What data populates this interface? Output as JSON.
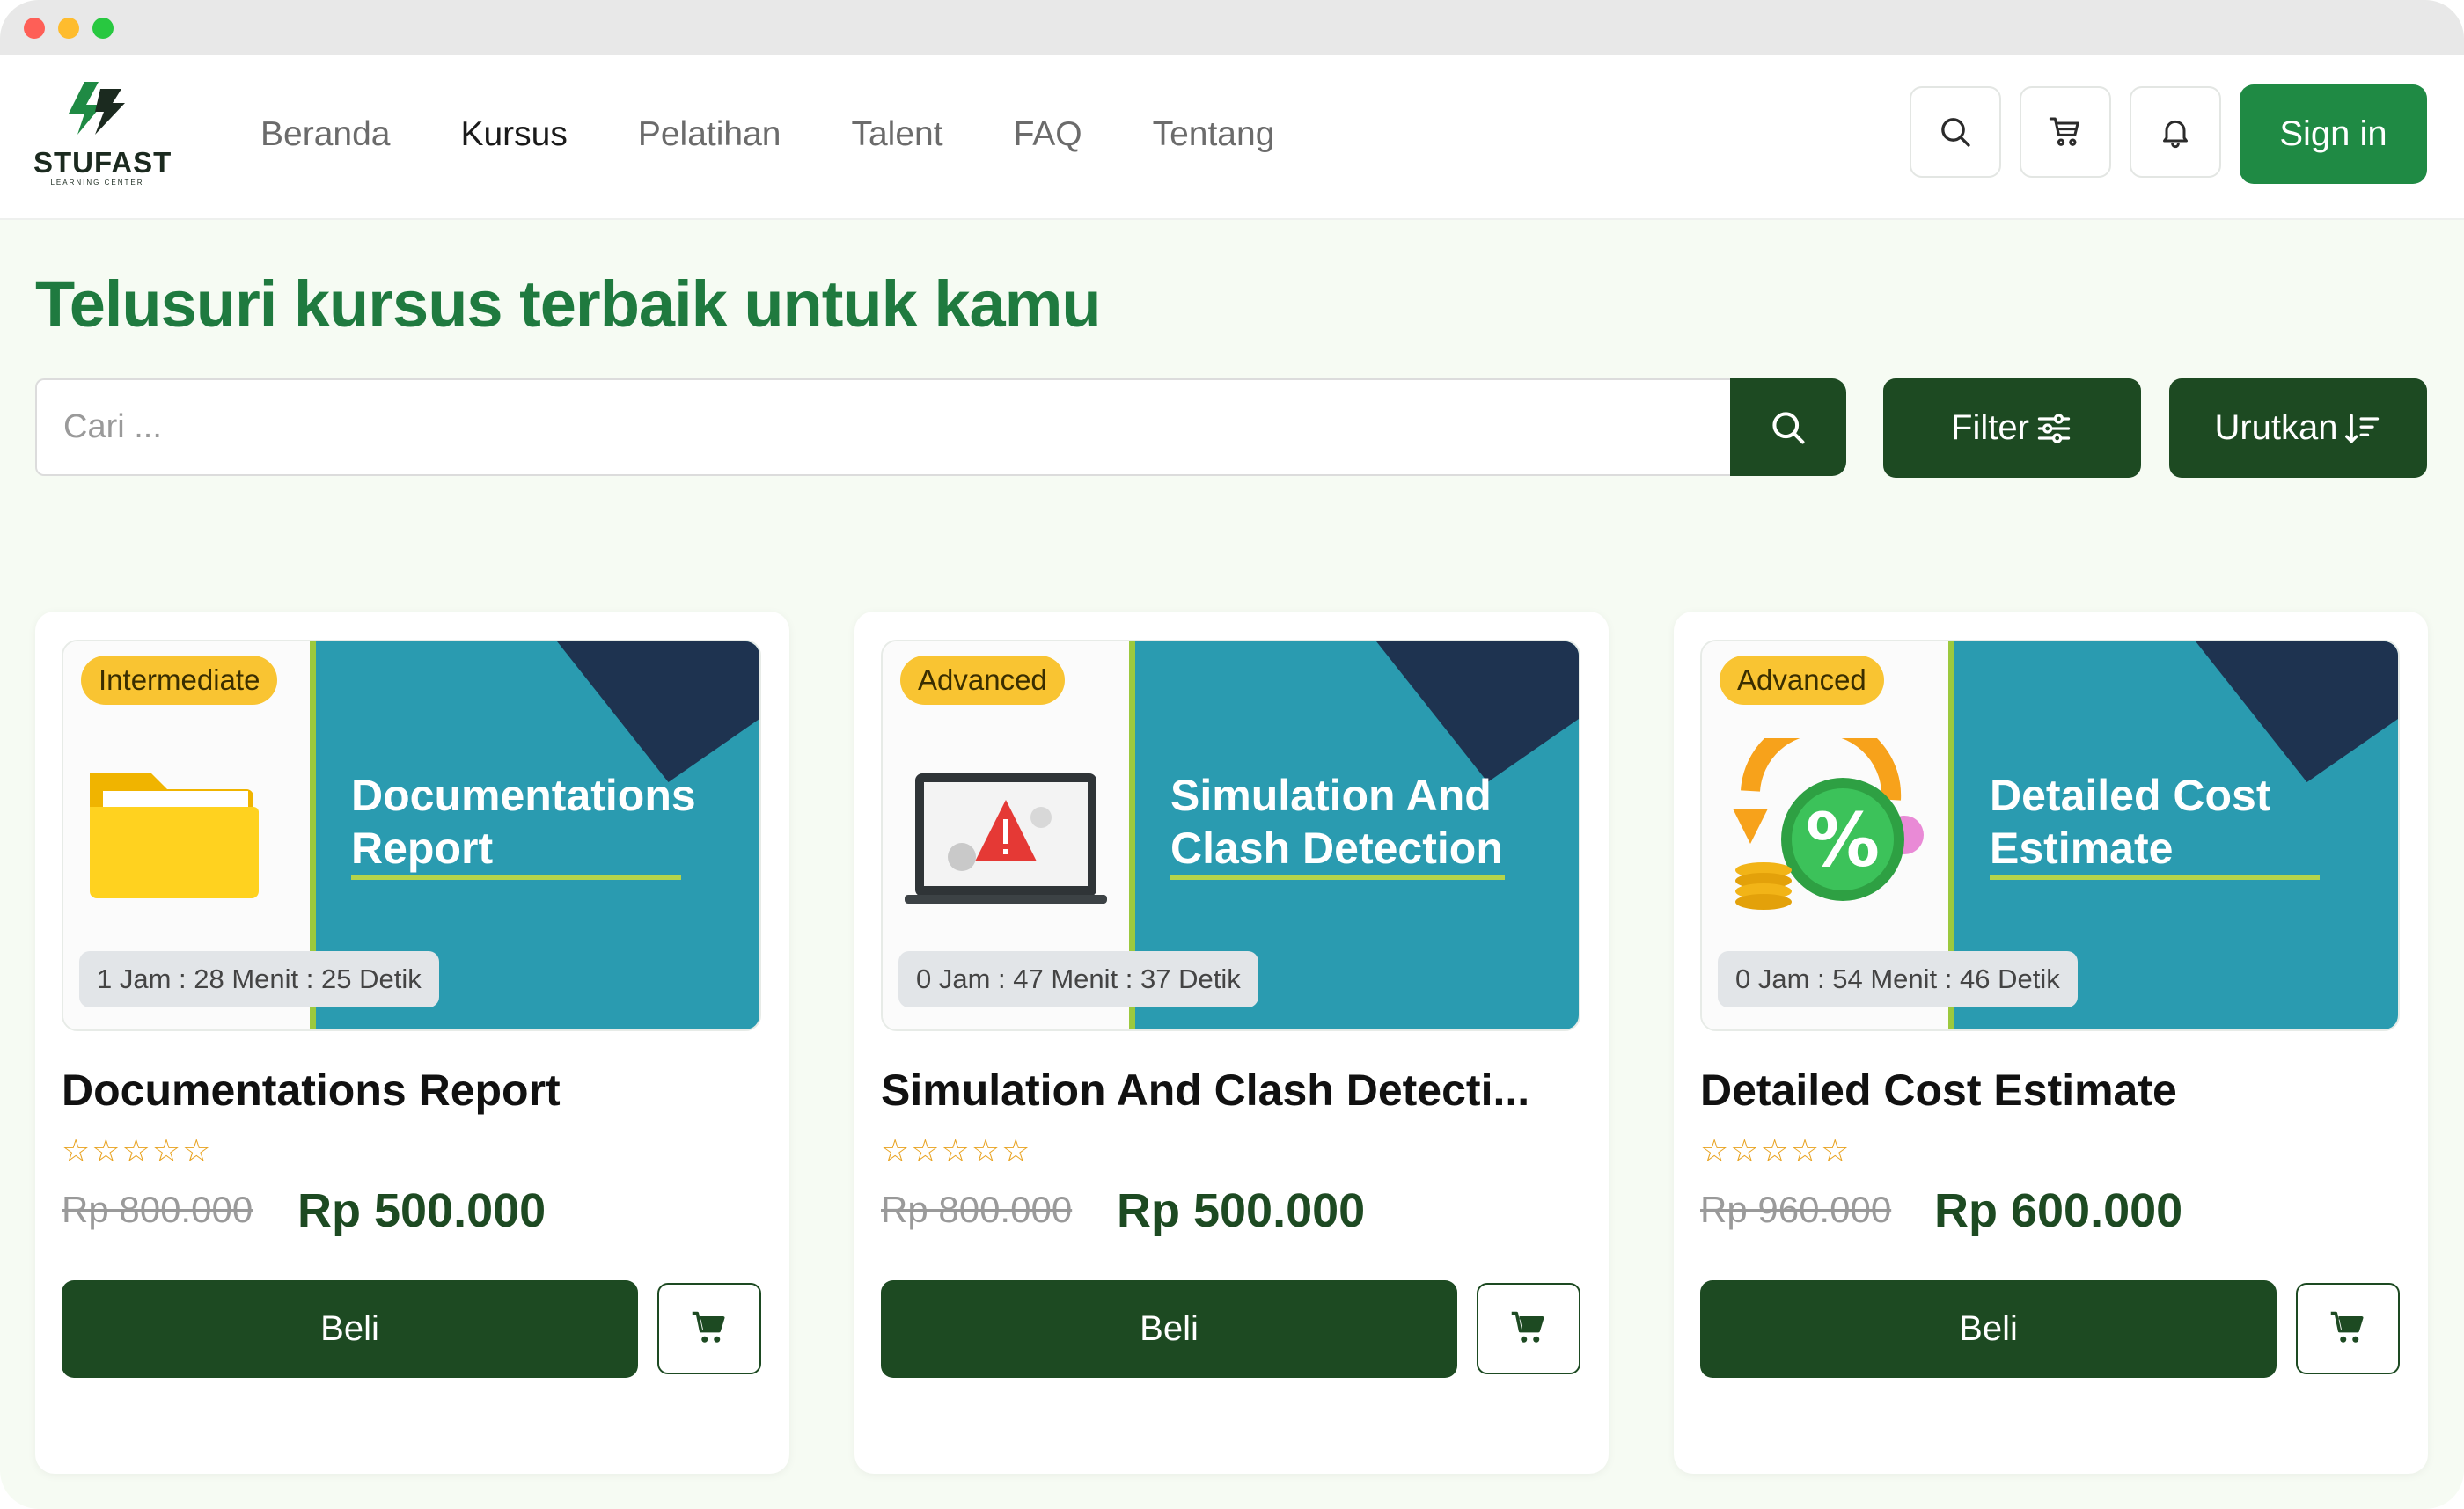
{
  "brand": {
    "name": "STUFAST",
    "tagline": "LEARNING CENTER",
    "color": "#1f7a3f"
  },
  "nav": {
    "links": [
      "Beranda",
      "Kursus",
      "Pelatihan",
      "Talent",
      "FAQ",
      "Tentang"
    ],
    "active": "Kursus",
    "icons": [
      "search-icon",
      "cart-icon",
      "bell-icon"
    ],
    "signin_label": "Sign in"
  },
  "page": {
    "title": "Telusuri kursus terbaik untuk kamu"
  },
  "search": {
    "placeholder": "Cari ...",
    "value": ""
  },
  "actions": {
    "filter_label": "Filter",
    "sort_label": "Urutkan"
  },
  "courses": [
    {
      "level": "Intermediate",
      "duration": "1 Jam : 28 Menit : 25 Detik",
      "thumb_title": "Documentations Report",
      "title": "Documentations Report",
      "stars": "☆☆☆☆☆",
      "price_old": "Rp 800.000",
      "price_new": "Rp 500.000",
      "buy_label": "Beli",
      "art": "folder-icon"
    },
    {
      "level": "Advanced",
      "duration": "0 Jam : 47 Menit : 37 Detik",
      "thumb_title": "Simulation And Clash Detection",
      "title": "Simulation And Clash Detecti...",
      "stars": "☆☆☆☆☆",
      "price_old": "Rp 800.000",
      "price_new": "Rp 500.000",
      "buy_label": "Beli",
      "art": "laptop-warning-icon"
    },
    {
      "level": "Advanced",
      "duration": "0 Jam : 54 Menit : 46 Detik",
      "thumb_title": "Detailed Cost Estimate",
      "title": "Detailed Cost Estimate",
      "stars": "☆☆☆☆☆",
      "price_old": "Rp 960.000",
      "price_new": "Rp 600.000",
      "buy_label": "Beli",
      "art": "discount-coins-icon"
    }
  ]
}
